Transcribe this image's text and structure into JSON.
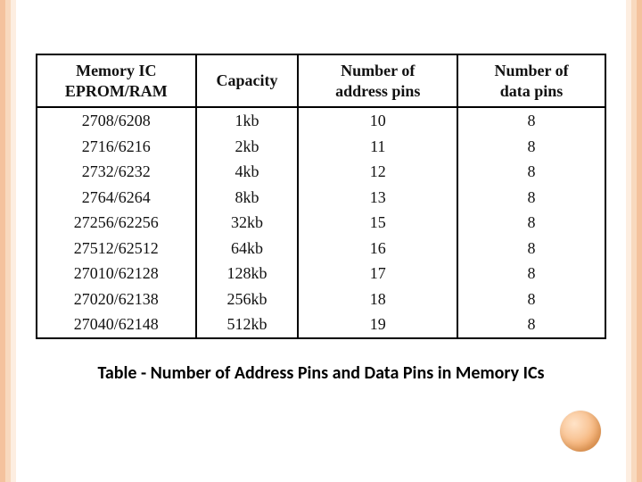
{
  "chart_data": {
    "type": "table",
    "title": "Table - Number of Address Pins and Data Pins in Memory ICs",
    "columns": [
      "Memory IC EPROM/RAM",
      "Capacity",
      "Number of address pins",
      "Number of data pins"
    ],
    "rows": [
      [
        "2708/6208",
        "1kb",
        10,
        8
      ],
      [
        "2716/6216",
        "2kb",
        11,
        8
      ],
      [
        "2732/6232",
        "4kb",
        12,
        8
      ],
      [
        "2764/6264",
        "8kb",
        13,
        8
      ],
      [
        "27256/62256",
        "32kb",
        15,
        8
      ],
      [
        "27512/62512",
        "64kb",
        16,
        8
      ],
      [
        "27010/62128",
        "128kb",
        17,
        8
      ],
      [
        "27020/62138",
        "256kb",
        18,
        8
      ],
      [
        "27040/62148",
        "512kb",
        19,
        8
      ]
    ]
  },
  "headers": {
    "ic_line1": "Memory IC",
    "ic_line2": "EPROM/RAM",
    "cap": "Capacity",
    "addr_line1": "Number of",
    "addr_line2": "address pins",
    "data_line1": "Number of",
    "data_line2": "data pins"
  },
  "rows": [
    {
      "ic": "2708/6208",
      "cap": "1kb",
      "addr": "10",
      "data": "8"
    },
    {
      "ic": "2716/6216",
      "cap": "2kb",
      "addr": "11",
      "data": "8"
    },
    {
      "ic": "2732/6232",
      "cap": "4kb",
      "addr": "12",
      "data": "8"
    },
    {
      "ic": "2764/6264",
      "cap": "8kb",
      "addr": "13",
      "data": "8"
    },
    {
      "ic": "27256/62256",
      "cap": "32kb",
      "addr": "15",
      "data": "8"
    },
    {
      "ic": "27512/62512",
      "cap": "64kb",
      "addr": "16",
      "data": "8"
    },
    {
      "ic": "27010/62128",
      "cap": "128kb",
      "addr": "17",
      "data": "8"
    },
    {
      "ic": "27020/62138",
      "cap": "256kb",
      "addr": "18",
      "data": "8"
    },
    {
      "ic": "27040/62148",
      "cap": "512kb",
      "addr": "19",
      "data": "8"
    }
  ],
  "caption": "Table - Number of Address Pins and Data Pins in Memory ICs"
}
